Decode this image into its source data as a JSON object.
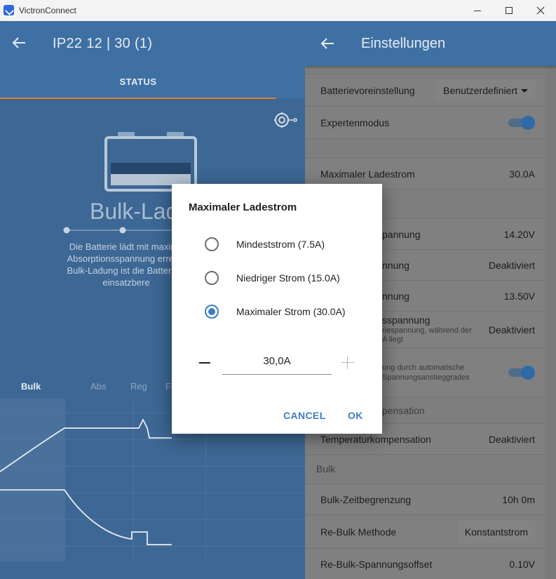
{
  "window": {
    "title": "VictronConnect"
  },
  "device": {
    "title": "IP22 12 | 30 (1)",
    "tab_status": "STATUS"
  },
  "status": {
    "state": "Bulk-Lad",
    "description": [
      "Die Batterie lädt mit maxima",
      "Absorptionsspannung erreich",
      "Bulk-Ladung ist die Batterie z",
      "einsatzbere"
    ],
    "phases": [
      "Bulk",
      "Abs",
      "Reg",
      "F"
    ]
  },
  "settings": {
    "title": "Einstellungen",
    "rows": {
      "battery_preset": {
        "label": "Batterievoreinstellung",
        "value": "Benutzerdefiniert"
      },
      "expert_mode": {
        "label": "Expertenmodus"
      },
      "max_charge_current": {
        "label": "Maximaler Ladestrom",
        "value": "30.0A"
      },
      "row_14_20": {
        "label": "pannung",
        "value": "14.20V"
      },
      "row_deakt1": {
        "label": "nnung",
        "value": "Deaktiviert"
      },
      "row_13_50": {
        "label": "nnung",
        "value": "13.50V"
      },
      "row_sspannung": {
        "label": "sspannung",
        "sub1": "riespannung, während der",
        "sub2": "A liegt",
        "value": "Deaktiviert"
      },
      "row_auto": {
        "sub1": "ung durch automatische",
        "sub2": "Spannungsanstieggrades"
      },
      "section_temp": {
        "label": "pensation"
      },
      "temp_comp": {
        "label": "Temperaturkompensation",
        "value": "Deaktiviert"
      },
      "section_bulk": {
        "label": "Bulk"
      },
      "bulk_time_limit": {
        "label": "Bulk-Zeitbegrenzung",
        "value": "10h 0m"
      },
      "rebulk_method": {
        "label": "Re-Bulk Methode",
        "value": "Konstantstrom"
      },
      "rebulk_offset": {
        "label": "Re-Bulk-Spannungsoffset",
        "value": "0.10V"
      }
    }
  },
  "dialog": {
    "title": "Maximaler Ladestrom",
    "options": [
      {
        "label": "Mindeststrom (7.5A)",
        "selected": false
      },
      {
        "label": "Niedriger Strom (15.0A)",
        "selected": false
      },
      {
        "label": "Maximaler Strom (30.0A)",
        "selected": true
      }
    ],
    "amount": "30,0A",
    "cancel": "CANCEL",
    "ok": "OK"
  },
  "colors": {
    "accent": "#3f7cc4",
    "header_blue": "#3f70a3",
    "tab_indicator": "#e87a24"
  }
}
